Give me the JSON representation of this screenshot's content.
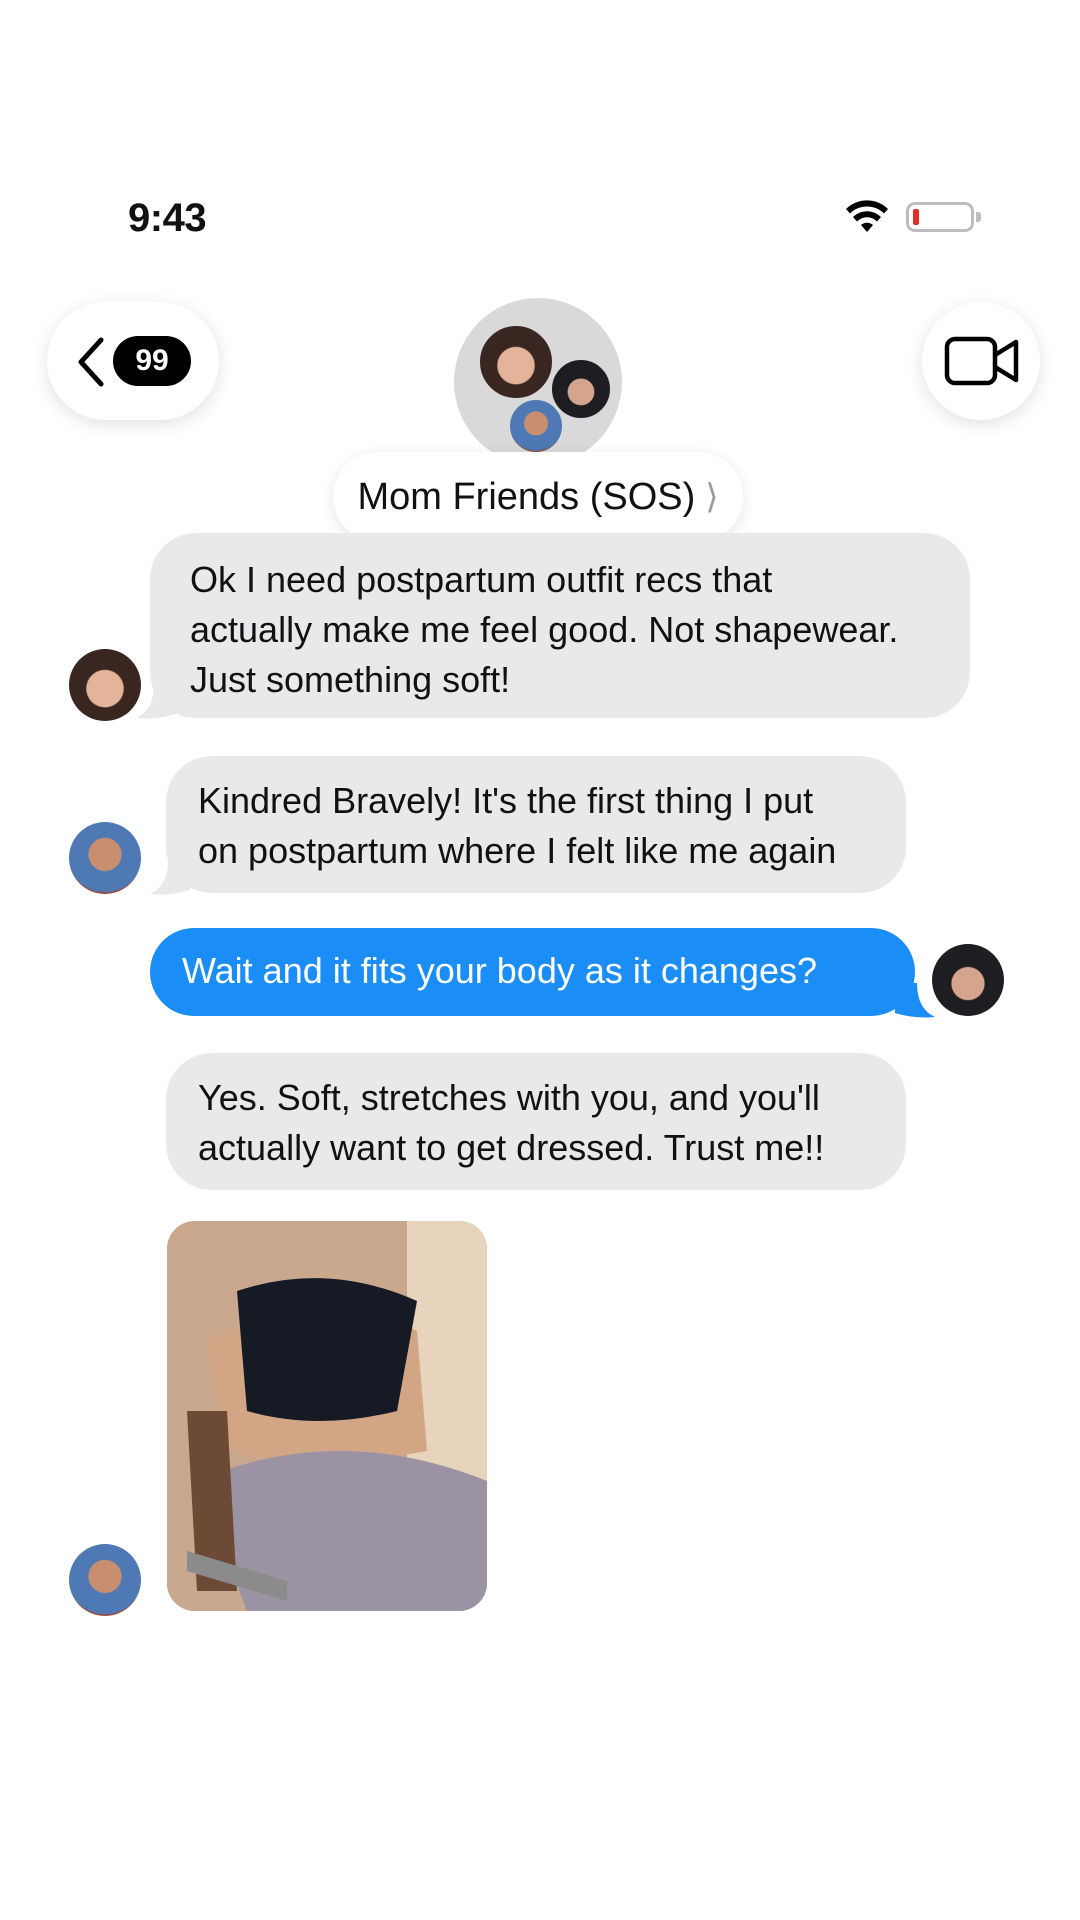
{
  "status_bar": {
    "time": "9:43",
    "battery_level_percent": 5,
    "battery_color": "#e0302a"
  },
  "nav": {
    "back_badge_count": "99",
    "group_name": "Mom Friends (SOS)",
    "pill_chevron": "⟩",
    "icons": [
      "chevron-left-icon",
      "video-camera-icon",
      "chevron-right-icon"
    ]
  },
  "messages": [
    {
      "direction": "incoming",
      "text_lines": [
        "Ok I need postpartum outfit recs that",
        "actually make me feel good. Not shapewear.",
        "Just something soft!"
      ]
    },
    {
      "direction": "incoming",
      "text_lines": [
        "Kindred Bravely! It's the first thing I put",
        "on postpartum where I felt like me again"
      ]
    },
    {
      "direction": "outgoing",
      "text_lines": [
        "Wait and it fits your body as it changes?"
      ]
    },
    {
      "direction": "incoming",
      "text_lines": [
        "Yes. Soft, stretches with you, and you'll",
        "actually want to get dressed. Trust me!!"
      ]
    },
    {
      "direction": "incoming",
      "type": "photo"
    }
  ],
  "colors": {
    "incoming_bubble": "#e9e9eb",
    "outgoing_bubble": "#1b8df6",
    "badge": "#000000"
  }
}
